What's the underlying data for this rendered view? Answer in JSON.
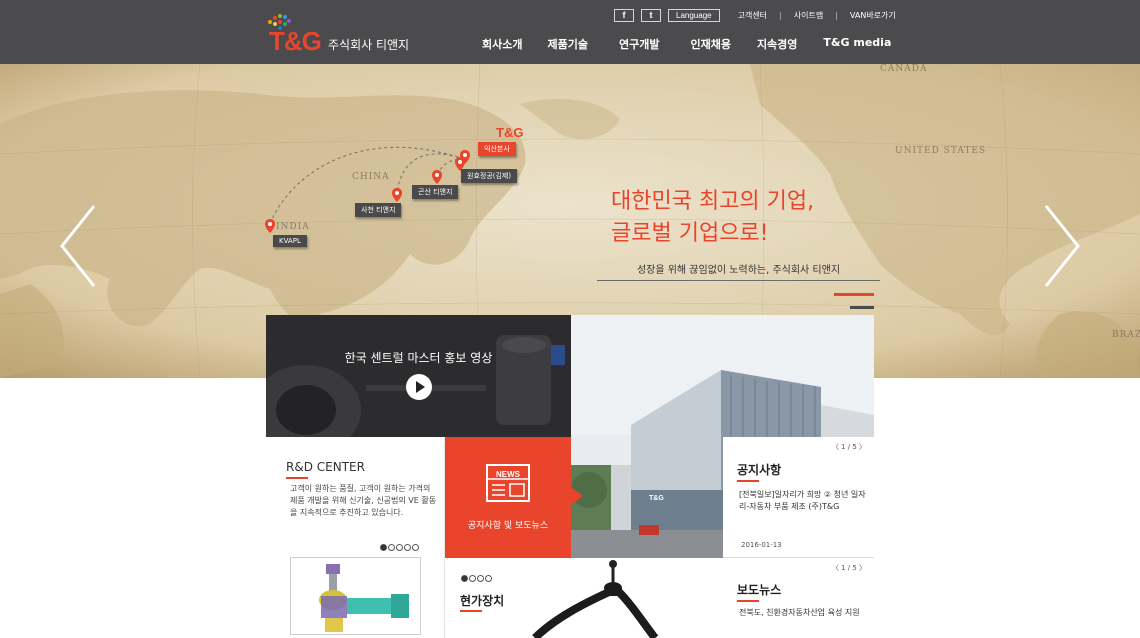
{
  "brand": {
    "logo_text": "T&G",
    "company_name": "주식회사 티앤지",
    "accent_color": "#e8452c",
    "header_color": "#4b4b4d"
  },
  "utility": {
    "facebook": "f",
    "twitter": "t",
    "language": "Language",
    "links": [
      "고객센터",
      "사이트맵",
      "VAN바로가기"
    ],
    "separator": "|"
  },
  "nav": [
    "회사소개",
    "제품기술",
    "연구개발",
    "인재채용",
    "지속경영",
    "T&G media"
  ],
  "hero": {
    "headline_1": "대한민국 최고의 기업,",
    "headline_2": "글로벌 기업으로!",
    "subcopy": "성장을 위해 끊임없이 노력하는, 주식회사 티앤지",
    "map_labels": [
      "CANADA",
      "UNITED STATES",
      "CHINA",
      "INDIA",
      "BRAZ"
    ],
    "map_logo": "T&G",
    "locations": [
      {
        "label": "익산본사",
        "highlight": true
      },
      {
        "label": "원효정공(김제)",
        "highlight": false
      },
      {
        "label": "곤산 티앤지",
        "highlight": false
      },
      {
        "label": "사천 티앤지",
        "highlight": false
      },
      {
        "label": "KVAPL",
        "highlight": false
      }
    ]
  },
  "video": {
    "title": "한국 센트럴 마스터 홍보 영상"
  },
  "rnd": {
    "title": "R&D CENTER",
    "description": "고객이 원하는 품질, 고객이 원하는 가격의 제품 개발을 위해 신기술, 신공법의 VE 활동을 지속적으로 추진하고 있습니다.",
    "carousel_active": 1,
    "carousel_total": 5
  },
  "news": {
    "icon_text": "NEWS",
    "label": "공지사항 및 보도뉴스"
  },
  "notice": {
    "pager": "〈   1 / 5   〉",
    "title": "공지사항",
    "text": "[전북일보]일자리가 희망 ② 청년 일자리-자동차 부품 제조 (주)T&G",
    "date": "2016-01-13"
  },
  "press": {
    "pager": "〈   1 / 5   〉",
    "title": "보도뉴스",
    "text": "전북도, 친환경자동차산업 육성 지원"
  },
  "device": {
    "title": "현가장치",
    "carousel_active": 1,
    "carousel_total": 4
  },
  "building_sign": "T&G"
}
